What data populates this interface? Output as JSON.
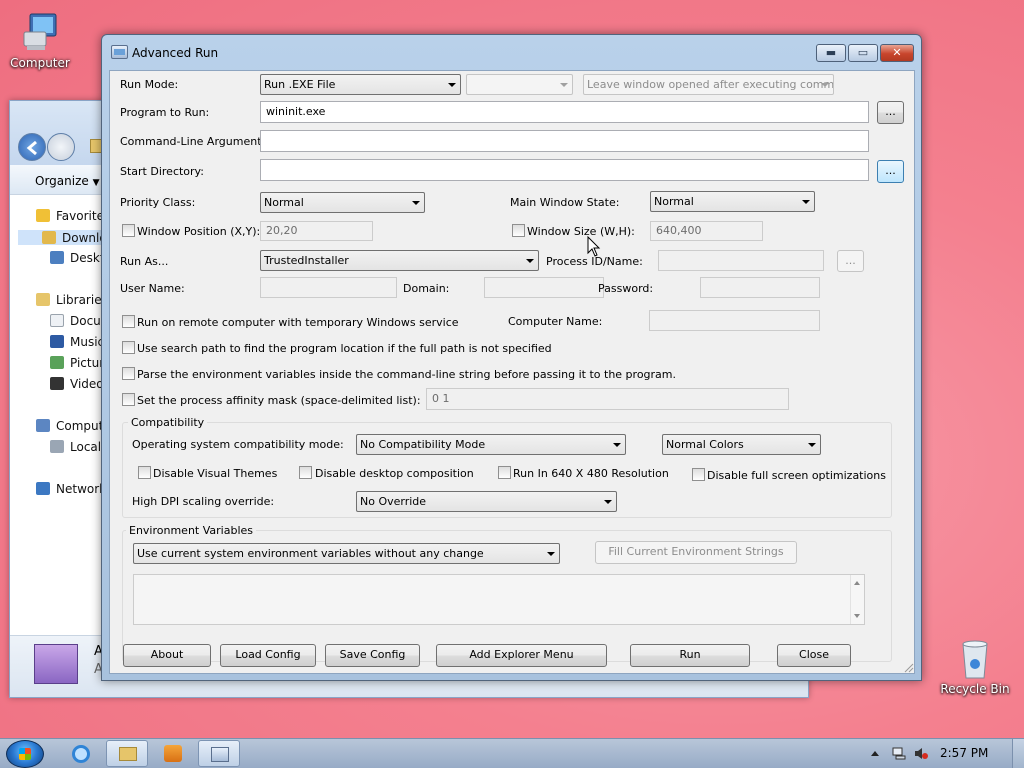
{
  "desktop": {
    "computer_label": "Computer",
    "recycle_label": "Recycle Bin"
  },
  "explorer": {
    "organize_label": "Organize",
    "nav": {
      "favorites": "Favorites",
      "downloads": "Downlo",
      "desktop": "Deskto",
      "libraries": "Libraries",
      "documents": "Docum",
      "music": "Music",
      "pictures": "Picture",
      "videos": "Videos",
      "computer": "Comput",
      "local_disk": "Local D",
      "network": "Network"
    },
    "details_letter_a1": "A",
    "details_letter_a2": "A"
  },
  "dialog": {
    "title": "Advanced Run",
    "caption": {
      "minimize": "▬",
      "maximize": "▭",
      "close": "✕"
    },
    "run_mode": {
      "label": "Run Mode:",
      "value": "Run .EXE File",
      "secondary": "",
      "window_option": "Leave window opened after executing comman"
    },
    "program": {
      "label": "Program to Run:",
      "value": "wininit.exe",
      "browse": "..."
    },
    "cmdline": {
      "label": "Command-Line Arguments:",
      "value": ""
    },
    "startdir": {
      "label": "Start Directory:",
      "value": "",
      "browse": "..."
    },
    "priority": {
      "label": "Priority Class:",
      "value": "Normal"
    },
    "main_window_state": {
      "label": "Main Window State:",
      "value": "Normal"
    },
    "window_position": {
      "label": "Window Position (X,Y):",
      "value": "20,20"
    },
    "window_size": {
      "label": "Window Size (W,H):",
      "value": "640,400"
    },
    "run_as": {
      "label": "Run As...",
      "value": "TrustedInstaller"
    },
    "process_id": {
      "label": "Process ID/Name:",
      "value": "",
      "browse": "..."
    },
    "user_name": {
      "label": "User Name:",
      "value": ""
    },
    "domain": {
      "label": "Domain:",
      "value": ""
    },
    "password": {
      "label": "Password:",
      "value": ""
    },
    "remote": {
      "label": "Run on remote computer with temporary Windows service"
    },
    "computer_name": {
      "label": "Computer Name:",
      "value": ""
    },
    "search_path": {
      "label": "Use search path to find the program location if the full path is not specified"
    },
    "parse_env": {
      "label": "Parse the environment variables inside the command-line string before passing it to the program."
    },
    "affinity": {
      "label": "Set the process affinity mask (space-delimited list):",
      "value": "0 1"
    },
    "compat": {
      "title": "Compatibility",
      "os_mode_label": "Operating system compatibility mode:",
      "os_mode_value": "No Compatibility Mode",
      "colors_value": "Normal Colors",
      "disable_themes": "Disable Visual Themes",
      "disable_composition": "Disable desktop composition",
      "run_640": "Run In 640 X 480 Resolution",
      "disable_fullscreen": "Disable full screen optimizations",
      "dpi_label": "High DPI scaling override:",
      "dpi_value": "No Override"
    },
    "env": {
      "title": "Environment Variables",
      "mode_value": "Use current system environment variables without any change",
      "fill_button": "Fill Current Environment Strings",
      "strings": ""
    },
    "buttons": {
      "about": "About",
      "load": "Load Config",
      "save": "Save Config",
      "explorer_menu": "Add Explorer Menu",
      "run": "Run",
      "close": "Close"
    }
  },
  "taskbar": {
    "time": "2:57 PM"
  }
}
